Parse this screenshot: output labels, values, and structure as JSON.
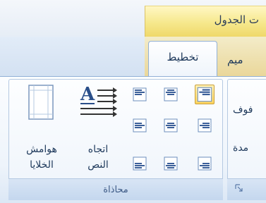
{
  "contextual_group": {
    "label": "ت الجدول"
  },
  "tabs": {
    "active": "تخطيط",
    "inactive": "ميم"
  },
  "alignment_group": {
    "caption": "محاذاة",
    "text_direction": {
      "line1": "اتجاه",
      "line2": "النص"
    },
    "cell_margins": {
      "line1": "هوامش",
      "line2": "الخلايا"
    },
    "buttons": [
      {
        "name": "align-top-right",
        "selected": true
      },
      {
        "name": "align-top-center",
        "selected": false
      },
      {
        "name": "align-top-left",
        "selected": false
      },
      {
        "name": "align-middle-right",
        "selected": false
      },
      {
        "name": "align-middle-center",
        "selected": false
      },
      {
        "name": "align-middle-left",
        "selected": false
      },
      {
        "name": "align-bottom-right",
        "selected": false
      },
      {
        "name": "align-bottom-center",
        "selected": false
      },
      {
        "name": "align-bottom-left",
        "selected": false
      }
    ]
  },
  "next_group": {
    "item1": "فوف",
    "item2": "مدة"
  },
  "colors": {
    "accent": "#ffd55d",
    "text": "#1e395b",
    "border": "#92b1d6",
    "icon_blue": "#3b5f99"
  },
  "icons": [
    "text-direction-icon",
    "cell-margins-icon",
    "dialog-launcher-icon"
  ]
}
